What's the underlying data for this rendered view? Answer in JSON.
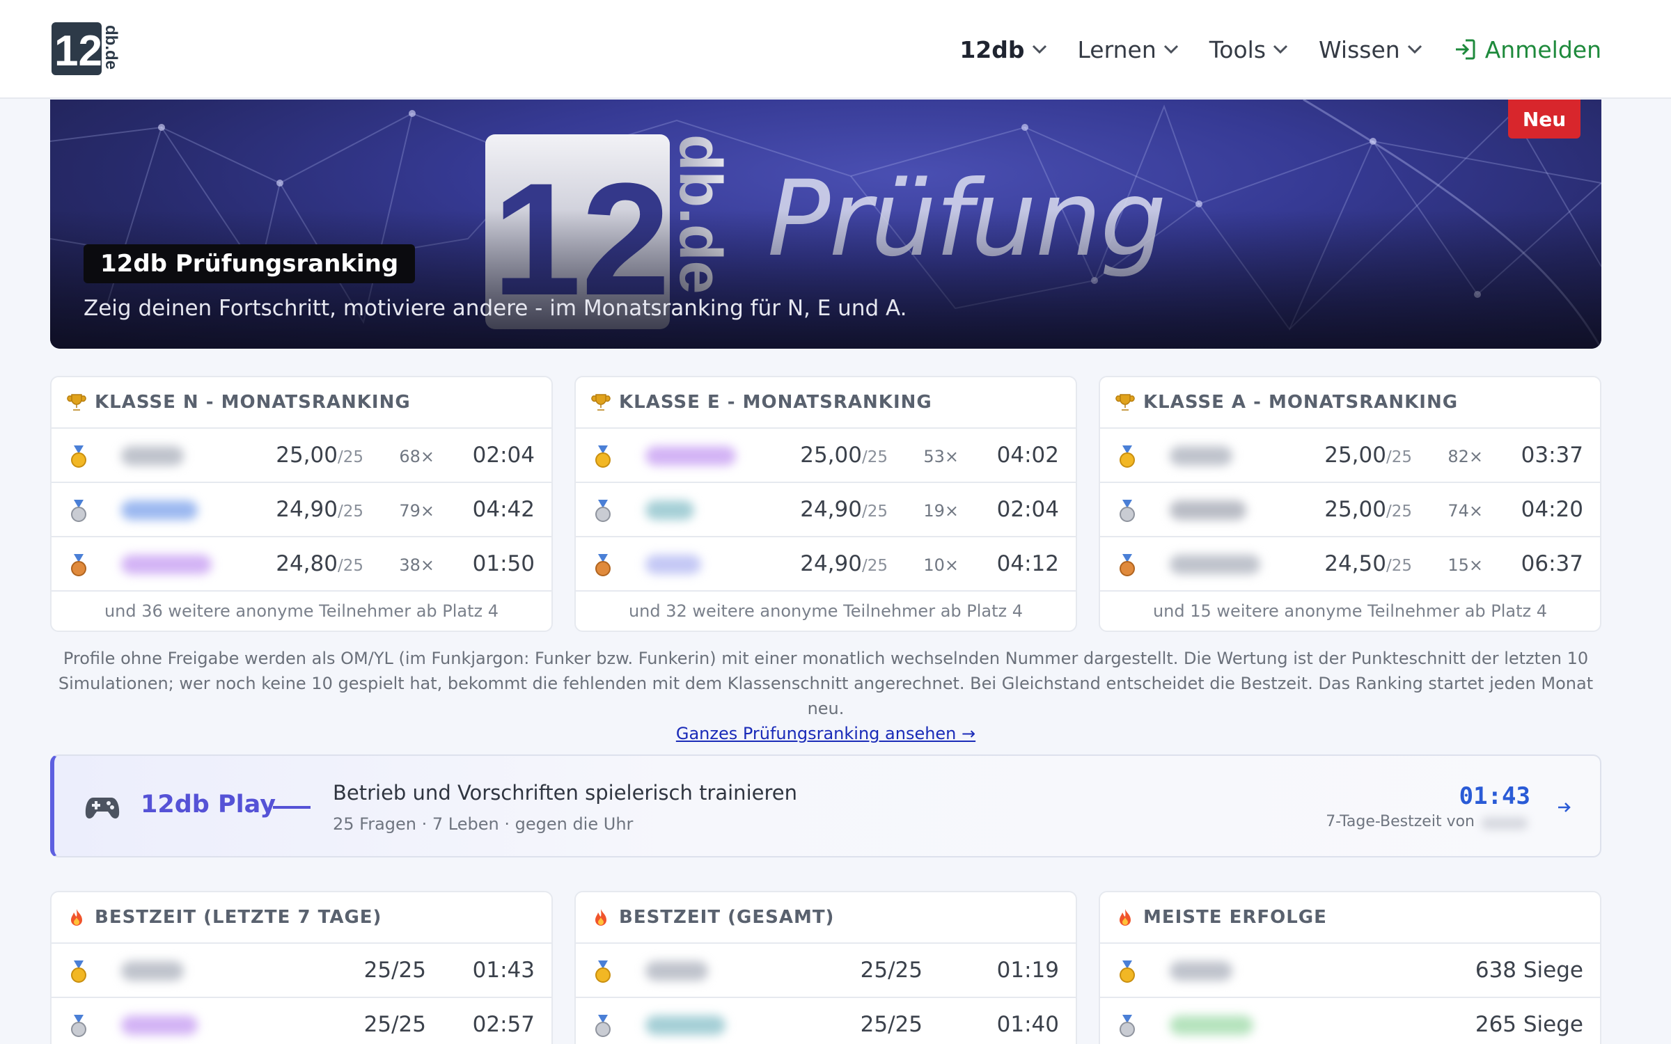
{
  "header": {
    "nav": [
      {
        "label": "12db"
      },
      {
        "label": "Lernen"
      },
      {
        "label": "Tools"
      },
      {
        "label": "Wissen"
      }
    ],
    "login_label": "Anmelden"
  },
  "hero": {
    "badge": "Neu",
    "title": "12db Prüfungsranking",
    "subtitle": "Zeig deinen Fortschritt, motiviere andere - im Monatsranking für N, E und A.",
    "word": "Prüfung"
  },
  "rankings": [
    {
      "title": "KLASSE N - MONATSRANKING",
      "footer": "und 36 weitere anonyme Teilnehmer ab Platz 4",
      "rows": [
        {
          "score": "25,00",
          "of": "/25",
          "count": "68×",
          "time": "02:04"
        },
        {
          "score": "24,90",
          "of": "/25",
          "count": "79×",
          "time": "04:42"
        },
        {
          "score": "24,80",
          "of": "/25",
          "count": "38×",
          "time": "01:50"
        }
      ]
    },
    {
      "title": "KLASSE E - MONATSRANKING",
      "footer": "und 32 weitere anonyme Teilnehmer ab Platz 4",
      "rows": [
        {
          "score": "25,00",
          "of": "/25",
          "count": "53×",
          "time": "04:02"
        },
        {
          "score": "24,90",
          "of": "/25",
          "count": "19×",
          "time": "02:04"
        },
        {
          "score": "24,90",
          "of": "/25",
          "count": "10×",
          "time": "04:12"
        }
      ]
    },
    {
      "title": "KLASSE A - MONATSRANKING",
      "footer": "und 15 weitere anonyme Teilnehmer ab Platz 4",
      "rows": [
        {
          "score": "25,00",
          "of": "/25",
          "count": "82×",
          "time": "03:37"
        },
        {
          "score": "25,00",
          "of": "/25",
          "count": "74×",
          "time": "04:20"
        },
        {
          "score": "24,50",
          "of": "/25",
          "count": "15×",
          "time": "06:37"
        }
      ]
    }
  ],
  "note": {
    "line1": "Profile ohne Freigabe werden als OM/YL (im Funkjargon: Funker bzw. Funkerin) mit einer monatlich wechselnden Nummer dargestellt. Die Wertung ist der Punkteschnitt der letzten 10",
    "line2": "Simulationen; wer noch keine 10 gespielt hat, bekommt die fehlenden mit dem Klassenschnitt angerechnet. Bei Gleichstand entscheidet die Bestzeit. Das Ranking startet jeden Monat neu.",
    "link": "Ganzes Prüfungsranking ansehen →"
  },
  "play": {
    "title": "12db Play",
    "text": "Betrieb und Vorschriften spielerisch trainieren",
    "meta": "25 Fragen · 7 Leben · gegen die Uhr",
    "best_time": "01:43",
    "best_label": "7-Tage-Bestzeit von"
  },
  "leaders": [
    {
      "title": "BESTZEIT (LETZTE 7 TAGE)",
      "rows": [
        {
          "score": "25/25",
          "time": "01:43"
        },
        {
          "score": "25/25",
          "time": "02:57"
        }
      ]
    },
    {
      "title": "BESTZEIT (GESAMT)",
      "rows": [
        {
          "score": "25/25",
          "time": "01:19"
        },
        {
          "score": "25/25",
          "time": "01:40"
        }
      ]
    },
    {
      "title": "MEISTE ERFOLGE",
      "rows": [
        {
          "wins": "638 Siege"
        },
        {
          "wins": "265 Siege"
        }
      ]
    }
  ],
  "colors": {
    "accent_green": "#1e8a3c",
    "accent_purple": "#5552d6",
    "badge_red": "#d8262c",
    "time_blue": "#2a5bd6"
  }
}
